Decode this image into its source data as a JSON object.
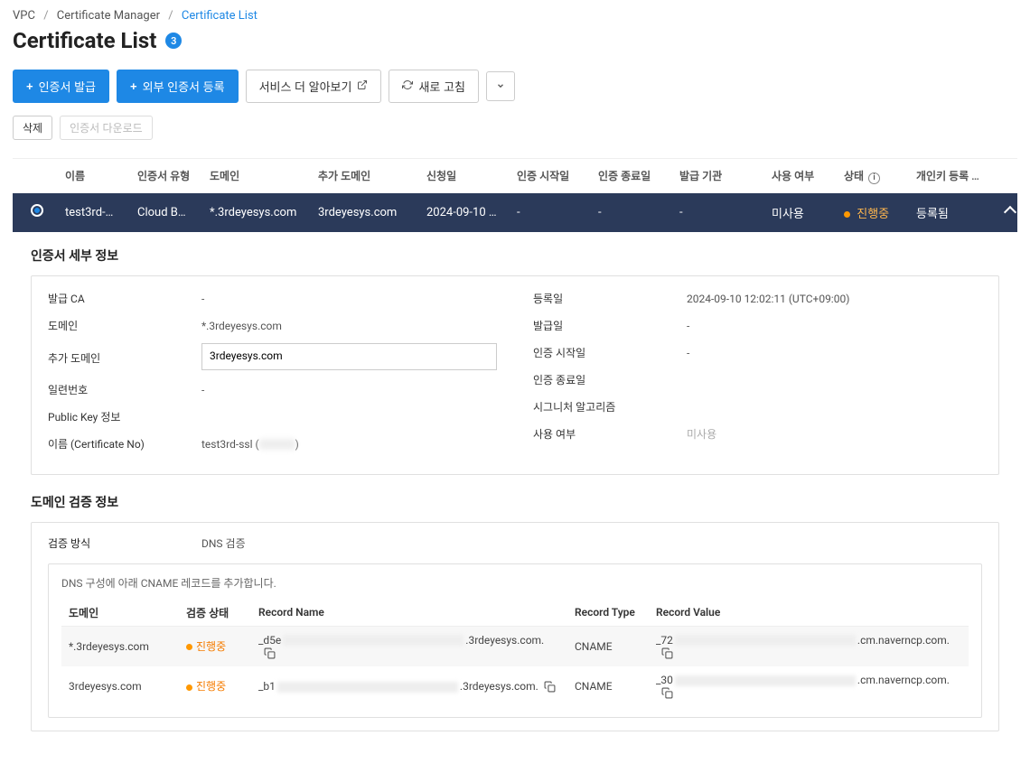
{
  "breadcrumb": {
    "vpc": "VPC",
    "cm": "Certificate Manager",
    "current": "Certificate List"
  },
  "page": {
    "title": "Certificate List",
    "count": "3"
  },
  "toolbar": {
    "issue": "인증서 발급",
    "register_ext": "외부 인증서 등록",
    "learn_more": "서비스 더 알아보기",
    "refresh": "새로 고침"
  },
  "toolbar2": {
    "delete": "삭제",
    "download": "인증서 다운로드"
  },
  "columns": {
    "name": "이름",
    "type": "인증서 유형",
    "domain": "도메인",
    "extra": "추가 도메인",
    "request": "신청일",
    "start": "인증 시작일",
    "end": "인증 종료일",
    "issuer": "발급 기관",
    "usage": "사용 여부",
    "status": "상태",
    "key": "개인키 등록 여부"
  },
  "row": {
    "name": "test3rd-…",
    "type": "Cloud B…",
    "domain": "*.3rdeyesys.com",
    "extra": "3rdeyesys.com",
    "request": "2024-09-10 …",
    "start": "-",
    "end": "-",
    "issuer": "-",
    "usage": "미사용",
    "status": "진행중",
    "key": "등록됨"
  },
  "detail": {
    "section_title": "인증서 세부 정보",
    "ca_label": "발급 CA",
    "ca_value": "-",
    "domain_label": "도메인",
    "domain_value": "*.3rdeyesys.com",
    "extra_label": "추가 도메인",
    "extra_value": "3rdeyesys.com",
    "serial_label": "일련번호",
    "serial_value": "-",
    "pk_label": "Public Key 정보",
    "certno_label": "이름 (Certificate No)",
    "certno_value_pre": "test3rd-ssl (",
    "certno_value_post": ")",
    "reg_label": "등록일",
    "reg_value": "2024-09-10 12:02:11 (UTC+09:00)",
    "issue_label": "발급일",
    "issue_value": "-",
    "start_label": "인증 시작일",
    "start_value": "-",
    "end_label": "인증 종료일",
    "sig_label": "시그니처 알고리즘",
    "usage_label": "사용 여부",
    "usage_value": "미사용"
  },
  "verify": {
    "section_title": "도메인 검증 정보",
    "method_label": "검증 방식",
    "method_value": "DNS 검증",
    "dns_note": "DNS 구성에 아래 CNAME 레코드를 추가합니다.",
    "th_domain": "도메인",
    "th_status": "검증 상태",
    "th_recname": "Record Name",
    "th_rectype": "Record Type",
    "th_recval": "Record Value",
    "rows": [
      {
        "domain": "*.3rdeyesys.com",
        "status": "진행중",
        "rec_pre": "_d5e",
        "rec_suf": ".3rdeyesys.com.",
        "type": "CNAME",
        "val_pre": "_72",
        "val_suf": ".cm.naverncp.com."
      },
      {
        "domain": "3rdeyesys.com",
        "status": "진행중",
        "rec_pre": "_b1",
        "rec_suf": ".3rdeyesys.com.",
        "type": "CNAME",
        "val_pre": "_30",
        "val_suf": ".cm.naverncp.com."
      }
    ]
  }
}
